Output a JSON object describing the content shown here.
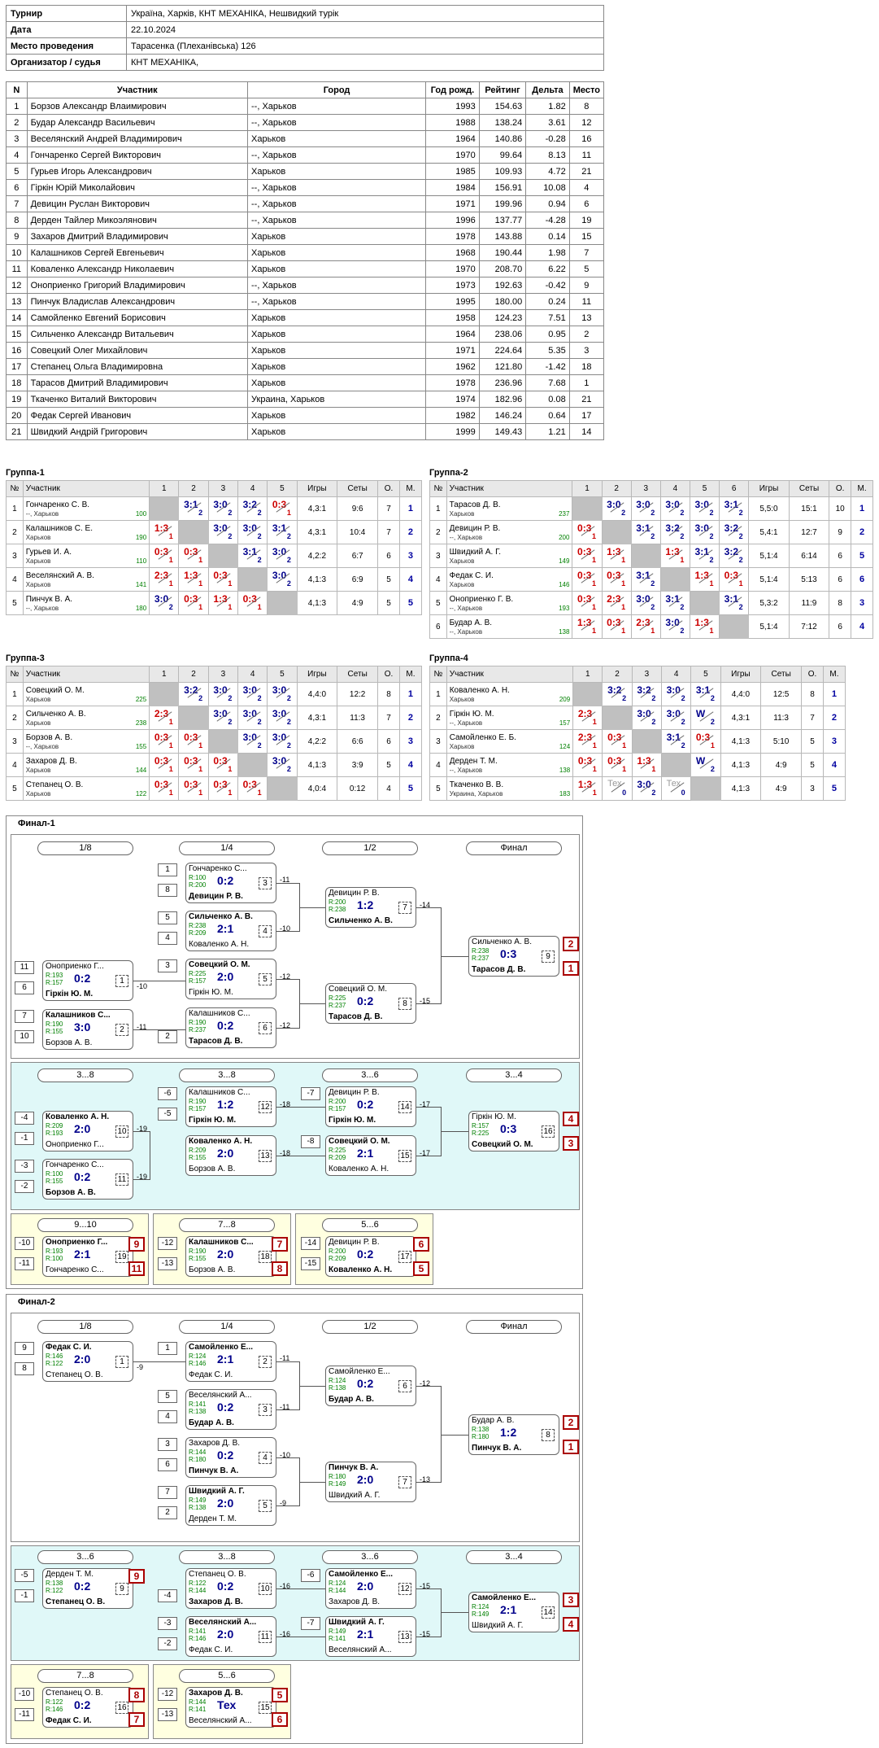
{
  "info": {
    "rows": [
      {
        "k": "Турнир",
        "v": "Україна, Харків, КНТ МЕХАНІКА, Нешвидкий турік"
      },
      {
        "k": "Дата",
        "v": "22.10.2024"
      },
      {
        "k": "Место проведения",
        "v": "Тарасенка (Плеханівська) 126"
      },
      {
        "k": "Организатор / судья",
        "v": "КНТ МЕХАНІКА,"
      }
    ]
  },
  "participants": {
    "headers": [
      "N",
      "Участник",
      "Город",
      "Год рожд.",
      "Рейтинг",
      "Дельта",
      "Место"
    ],
    "rows": [
      [
        "1",
        "Борзов Александр Влаимирович",
        "--, Харьков",
        "1993",
        "154.63",
        "1.82",
        "8"
      ],
      [
        "2",
        "Будар Александр Васильевич",
        "--, Харьков",
        "1988",
        "138.24",
        "3.61",
        "12"
      ],
      [
        "3",
        "Веселянский Андрей Владимирович",
        "Харьков",
        "1964",
        "140.86",
        "-0.28",
        "16"
      ],
      [
        "4",
        "Гончаренко Сергей Викторович",
        "--, Харьков",
        "1970",
        "99.64",
        "8.13",
        "11"
      ],
      [
        "5",
        "Гурьев Игорь Александрович",
        "Харьков",
        "1985",
        "109.93",
        "4.72",
        "21"
      ],
      [
        "6",
        "Гіркін Юрій Миколайович",
        "--, Харьков",
        "1984",
        "156.91",
        "10.08",
        "4"
      ],
      [
        "7",
        "Девицин Руслан Викторович",
        "--, Харьков",
        "1971",
        "199.96",
        "0.94",
        "6"
      ],
      [
        "8",
        "Дерден Тайлер Микоэлянович",
        "--, Харьков",
        "1996",
        "137.77",
        "-4.28",
        "19"
      ],
      [
        "9",
        "Захаров Дмитрий Владимирович",
        "Харьков",
        "1978",
        "143.88",
        "0.14",
        "15"
      ],
      [
        "10",
        "Калашников Сергей Евгеньевич",
        "Харьков",
        "1968",
        "190.44",
        "1.98",
        "7"
      ],
      [
        "11",
        "Коваленко Александр Николаевич",
        "Харьков",
        "1970",
        "208.70",
        "6.22",
        "5"
      ],
      [
        "12",
        "Оноприенко Григорий Владимирович",
        "--, Харьков",
        "1973",
        "192.63",
        "-0.42",
        "9"
      ],
      [
        "13",
        "Пинчук Владислав Александрович",
        "--, Харьков",
        "1995",
        "180.00",
        "0.24",
        "11"
      ],
      [
        "14",
        "Самойленко Евгений Борисович",
        "Харьков",
        "1958",
        "124.23",
        "7.51",
        "13"
      ],
      [
        "15",
        "Сильченко Александр Витальевич",
        "Харьков",
        "1964",
        "238.06",
        "0.95",
        "2"
      ],
      [
        "16",
        "Совецкий Олег Михайлович",
        "Харьков",
        "1971",
        "224.64",
        "5.35",
        "3"
      ],
      [
        "17",
        "Степанец Ольга Владимировна",
        "Харьков",
        "1962",
        "121.80",
        "-1.42",
        "18"
      ],
      [
        "18",
        "Тарасов Дмитрий Владимирович",
        "Харьков",
        "1978",
        "236.96",
        "7.68",
        "1"
      ],
      [
        "19",
        "Ткаченко Виталий Викторович",
        "Украина, Харьков",
        "1974",
        "182.96",
        "0.08",
        "21"
      ],
      [
        "20",
        "Федак Сергей Иванович",
        "Харьков",
        "1982",
        "146.24",
        "0.64",
        "17"
      ],
      [
        "21",
        "Швидкий Андрій Григорович",
        "Харьков",
        "1999",
        "149.43",
        "1.21",
        "14"
      ]
    ]
  },
  "groups": [
    {
      "title": "Группа-1",
      "n": 5,
      "rows": [
        {
          "nm": "Гончаренко С. В.",
          "ct": "--, Харьков",
          "rt": "100",
          "s": [
            "x",
            "3:1/2",
            "3:0/2",
            "3:2/2",
            "0:3/1"
          ],
          "g": "4,3:1",
          "st": "9:6",
          "o": "7",
          "m": "1"
        },
        {
          "nm": "Калашников С. Е.",
          "ct": "Харьков",
          "rt": "190",
          "s": [
            "1:3/1",
            "x",
            "3:0/2",
            "3:0/2",
            "3:1/2"
          ],
          "g": "4,3:1",
          "st": "10:4",
          "o": "7",
          "m": "2"
        },
        {
          "nm": "Гурьев И. А.",
          "ct": "Харьков",
          "rt": "110",
          "s": [
            "0:3/1",
            "0:3/1",
            "x",
            "3:1/2",
            "3:0/2"
          ],
          "g": "4,2:2",
          "st": "6:7",
          "o": "6",
          "m": "3"
        },
        {
          "nm": "Веселянский А. В.",
          "ct": "Харьков",
          "rt": "141",
          "s": [
            "2:3/1",
            "1:3/1",
            "0:3/1",
            "x",
            "3:0/2"
          ],
          "g": "4,1:3",
          "st": "6:9",
          "o": "5",
          "m": "4"
        },
        {
          "nm": "Пинчук В. А.",
          "ct": "--, Харьков",
          "rt": "180",
          "s": [
            "3:0/2",
            "0:3/1",
            "1:3/1",
            "0:3/1",
            "x"
          ],
          "g": "4,1:3",
          "st": "4:9",
          "o": "5",
          "m": "5"
        }
      ]
    },
    {
      "title": "Группа-2",
      "n": 6,
      "rows": [
        {
          "nm": "Тарасов Д. В.",
          "ct": "Харьков",
          "rt": "237",
          "s": [
            "x",
            "3:0/2",
            "3:0/2",
            "3:0/2",
            "3:0/2",
            "3:1/2"
          ],
          "g": "5,5:0",
          "st": "15:1",
          "o": "10",
          "m": "1"
        },
        {
          "nm": "Девицин Р. В.",
          "ct": "--, Харьков",
          "rt": "200",
          "s": [
            "0:3/1",
            "x",
            "3:1/2",
            "3:2/2",
            "3:0/2",
            "3:2/2"
          ],
          "g": "5,4:1",
          "st": "12:7",
          "o": "9",
          "m": "2"
        },
        {
          "nm": "Швидкий А. Г.",
          "ct": "Харьков",
          "rt": "149",
          "s": [
            "0:3/1",
            "1:3/1",
            "x",
            "1:3/1",
            "3:1/2",
            "3:2/2"
          ],
          "g": "5,1:4",
          "st": "6:14",
          "o": "6",
          "m": "5"
        },
        {
          "nm": "Федак С. И.",
          "ct": "Харьков",
          "rt": "146",
          "s": [
            "0:3/1",
            "0:3/1",
            "3:1/2",
            "x",
            "1:3/1",
            "0:3/1"
          ],
          "g": "5,1:4",
          "st": "5:13",
          "o": "6",
          "m": "6"
        },
        {
          "nm": "Оноприенко Г. В.",
          "ct": "--, Харьков",
          "rt": "193",
          "s": [
            "0:3/1",
            "2:3/1",
            "3:0/2",
            "3:1/2",
            "x",
            "3:1/2"
          ],
          "g": "5,3:2",
          "st": "11:9",
          "o": "8",
          "m": "3"
        },
        {
          "nm": "Будар А. В.",
          "ct": "--, Харьков",
          "rt": "138",
          "s": [
            "1:3/1",
            "0:3/1",
            "2:3/1",
            "3:0/2",
            "1:3/1",
            "x"
          ],
          "g": "5,1:4",
          "st": "7:12",
          "o": "6",
          "m": "4"
        }
      ]
    },
    {
      "title": "Группа-3",
      "n": 5,
      "rows": [
        {
          "nm": "Совецкий О. М.",
          "ct": "Харьков",
          "rt": "225",
          "s": [
            "x",
            "3:2/2",
            "3:0/2",
            "3:0/2",
            "3:0/2"
          ],
          "g": "4,4:0",
          "st": "12:2",
          "o": "8",
          "m": "1"
        },
        {
          "nm": "Сильченко А. В.",
          "ct": "Харьков",
          "rt": "238",
          "s": [
            "2:3/1",
            "x",
            "3:0/2",
            "3:0/2",
            "3:0/2"
          ],
          "g": "4,3:1",
          "st": "11:3",
          "o": "7",
          "m": "2"
        },
        {
          "nm": "Борзов А. В.",
          "ct": "--, Харьков",
          "rt": "155",
          "s": [
            "0:3/1",
            "0:3/1",
            "x",
            "3:0/2",
            "3:0/2"
          ],
          "g": "4,2:2",
          "st": "6:6",
          "o": "6",
          "m": "3"
        },
        {
          "nm": "Захаров Д. В.",
          "ct": "Харьков",
          "rt": "144",
          "s": [
            "0:3/1",
            "0:3/1",
            "0:3/1",
            "x",
            "3:0/2"
          ],
          "g": "4,1:3",
          "st": "3:9",
          "o": "5",
          "m": "4"
        },
        {
          "nm": "Степанец О. В.",
          "ct": "Харьков",
          "rt": "122",
          "s": [
            "0:3/1",
            "0:3/1",
            "0:3/1",
            "0:3/1",
            "x"
          ],
          "g": "4,0:4",
          "st": "0:12",
          "o": "4",
          "m": "5"
        }
      ]
    },
    {
      "title": "Группа-4",
      "n": 5,
      "rows": [
        {
          "nm": "Коваленко А. Н.",
          "ct": "Харьков",
          "rt": "209",
          "s": [
            "x",
            "3:2/2",
            "3:2/2",
            "3:0/2",
            "3:1/2"
          ],
          "g": "4,4:0",
          "st": "12:5",
          "o": "8",
          "m": "1"
        },
        {
          "nm": "Гіркін Ю. М.",
          "ct": "--, Харьков",
          "rt": "157",
          "s": [
            "2:3/1",
            "x",
            "3:0/2",
            "3:0/2",
            "W/2"
          ],
          "g": "4,3:1",
          "st": "11:3",
          "o": "7",
          "m": "2"
        },
        {
          "nm": "Самойленко Е. Б.",
          "ct": "Харьков",
          "rt": "124",
          "s": [
            "2:3/1",
            "0:3/1",
            "x",
            "3:1/2",
            "0:3/1"
          ],
          "g": "4,1:3",
          "st": "5:10",
          "o": "5",
          "m": "3"
        },
        {
          "nm": "Дерден Т. М.",
          "ct": "--, Харьков",
          "rt": "138",
          "s": [
            "0:3/1",
            "0:3/1",
            "1:3/1",
            "x",
            "W/2"
          ],
          "g": "4,1:3",
          "st": "4:9",
          "o": "5",
          "m": "4"
        },
        {
          "nm": "Ткаченко В. В.",
          "ct": "Украина, Харьков",
          "rt": "183",
          "s": [
            "1:3/1",
            "Тех/0",
            "3:0/2",
            "Тех/0",
            "x"
          ],
          "g": "4,1:3",
          "st": "4:9",
          "o": "3",
          "m": "5"
        }
      ]
    }
  ],
  "group_headers": {
    "no": "№",
    "part": "Участник",
    "games": "Игры",
    "sets": "Сеты",
    "o": "О.",
    "m": "М."
  },
  "final1": {
    "title": "Финал-1",
    "rounds": [
      "1/8",
      "1/4",
      "1/2",
      "Финал",
      "3...8",
      "3...8",
      "3...6",
      "3...4",
      "9...10",
      "7...8",
      "5...6"
    ]
  },
  "final2": {
    "title": "Финал-2",
    "rounds": [
      "1/8",
      "1/4",
      "1/2",
      "Финал",
      "3...6",
      "3...8",
      "3...6",
      "3...4",
      "7...8",
      "5...6"
    ]
  }
}
